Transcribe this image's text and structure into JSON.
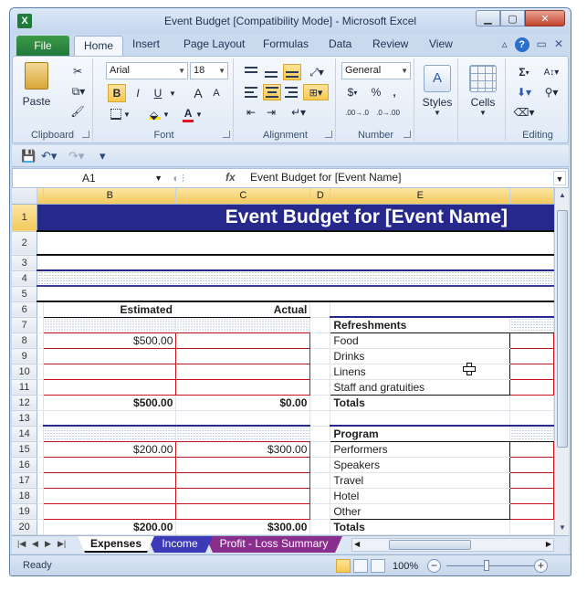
{
  "window": {
    "title": "Event Budget  [Compatibility Mode]  -  Microsoft Excel",
    "app_icon": "X"
  },
  "ribbon_tabs": {
    "file": "File",
    "tabs": [
      "Home",
      "Insert",
      "Page Layout",
      "Formulas",
      "Data",
      "Review",
      "View"
    ],
    "active": "Home",
    "help": "?"
  },
  "ribbon": {
    "clipboard": {
      "label": "Clipboard",
      "paste": "Paste"
    },
    "font": {
      "label": "Font",
      "font_name": "Arial",
      "font_size": "18",
      "bold": "B",
      "italic": "I",
      "underline": "U",
      "grow": "A",
      "shrink": "A",
      "font_color_letter": "A"
    },
    "alignment": {
      "label": "Alignment"
    },
    "number": {
      "label": "Number",
      "format": "General",
      "currency": "$",
      "percent": "%",
      "comma": ",",
      "inc_dec": ".00→.0",
      "dec_dec": ".0→.00"
    },
    "styles": {
      "label": "Styles"
    },
    "cells": {
      "label": "Cells"
    },
    "editing": {
      "label": "Editing",
      "sum": "Σ"
    }
  },
  "formula_bar": {
    "name_box": "A1",
    "fx": "fx",
    "content": "Event Budget for [Event Name]"
  },
  "columns": [
    "B",
    "C",
    "D",
    "E"
  ],
  "sheet": {
    "title": "Event Budget for [Event Name]",
    "headers": {
      "estimated": "Estimated",
      "actual": "Actual"
    },
    "rows": {
      "r8": {
        "est": "$500.00",
        "act": "",
        "label": "Food"
      },
      "r9": {
        "label": "Drinks"
      },
      "r10": {
        "label": "Linens"
      },
      "r11": {
        "label": "Staff and gratuities"
      },
      "r12": {
        "est": "$500.00",
        "act": "$0.00",
        "label": "Totals"
      },
      "r14": {
        "label": "Program"
      },
      "r15": {
        "est": "$200.00",
        "act": "$300.00",
        "label": "Performers"
      },
      "r16": {
        "label": "Speakers"
      },
      "r17": {
        "label": "Travel"
      },
      "r18": {
        "label": "Hotel"
      },
      "r19": {
        "label": "Other"
      },
      "r20": {
        "est": "$200.00",
        "act": "$300.00",
        "label": "Totals"
      }
    },
    "section_refreshments": "Refreshments",
    "row_numbers": [
      "1",
      "2",
      "3",
      "4",
      "5",
      "6",
      "7",
      "8",
      "9",
      "10",
      "11",
      "12",
      "13",
      "14",
      "15",
      "16",
      "17",
      "18",
      "19",
      "20"
    ]
  },
  "sheet_tabs": [
    "Expenses",
    "Income",
    "Profit - Loss Summary"
  ],
  "active_sheet": "Expenses",
  "status": {
    "mode": "Ready",
    "zoom": "100%"
  },
  "colors": {
    "title_fill": "#27288c",
    "red_border": "#c0151f",
    "tab_income": "#3c3ab6",
    "tab_profit": "#8a2e8e",
    "excel_green": "#1f7a3e"
  }
}
